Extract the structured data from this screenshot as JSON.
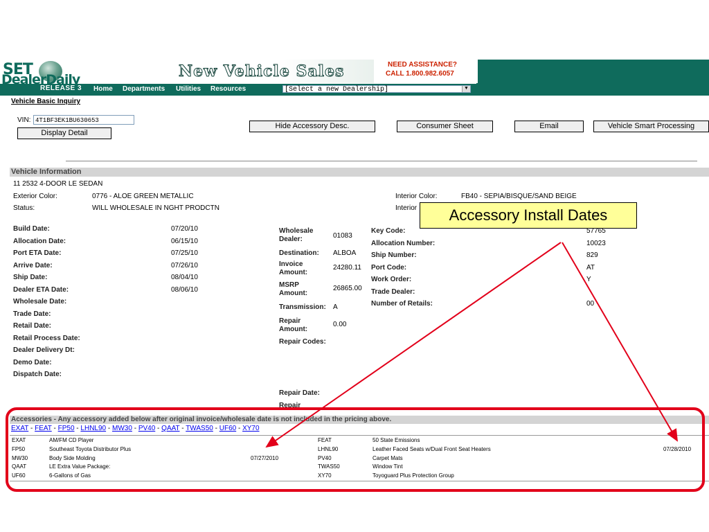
{
  "header": {
    "logo": {
      "line1": "SET",
      "line2": "DealerDaily",
      "release": "RELEASE 3"
    },
    "title": "New Vehicle Sales",
    "assist_line1": "NEED ASSISTANCE?",
    "assist_line2": "CALL 1.800.982.6057",
    "nav": [
      "Home",
      "Departments",
      "Utilities",
      "Resources"
    ],
    "dealer_select": "[Select a new Dealership]"
  },
  "breadcrumb": "Vehicle Basic Inquiry",
  "vin": {
    "label": "VIN:",
    "value": "4T1BF3EK1BU630653"
  },
  "buttons": {
    "display_detail": "Display Detail",
    "hide_accessory": "Hide Accessory Desc.",
    "consumer_sheet": "Consumer Sheet",
    "email": "Email",
    "smart_processing": "Vehicle Smart Processing"
  },
  "vehicle": {
    "section_title": "Vehicle Information",
    "model_line": "11 2532  4-DOOR LE SEDAN",
    "exterior_label": "Exterior Color:",
    "exterior_value": "0776 - ALOE GREEN METALLIC",
    "status_label": "Status:",
    "status_value": "WILL WHOLESALE IN NGHT PRODCTN",
    "interior_label": "Interior Color:",
    "interior_value": "FB40 - SEPIA/BISQUE/SAND BEIGE",
    "interior2_label": "Interior",
    "dates": [
      {
        "label": "Build Date:",
        "value": "07/20/10"
      },
      {
        "label": "Allocation Date:",
        "value": "06/15/10"
      },
      {
        "label": "Port ETA Date:",
        "value": "07/25/10"
      },
      {
        "label": "Arrive Date:",
        "value": "07/26/10"
      },
      {
        "label": "Ship Date:",
        "value": "08/04/10"
      },
      {
        "label": "Dealer ETA Date:",
        "value": "08/06/10"
      },
      {
        "label": "Wholesale Date:",
        "value": ""
      },
      {
        "label": "Trade Date:",
        "value": ""
      },
      {
        "label": "Retail Date:",
        "value": ""
      },
      {
        "label": "Retail Process Date:",
        "value": ""
      },
      {
        "label": "Dealer Delivery Dt:",
        "value": ""
      },
      {
        "label": "Demo Date:",
        "value": ""
      },
      {
        "label": "Dispatch Date:",
        "value": ""
      }
    ],
    "mid": [
      {
        "label": "Wholesale Dealer:",
        "value": "01083"
      },
      {
        "label": "Destination:",
        "value": "ALBOA"
      },
      {
        "label": "Invoice Amount:",
        "value": "24280.11"
      },
      {
        "label": "MSRP Amount:",
        "value": "26865.00"
      },
      {
        "label": "Transmission:",
        "value": "A"
      },
      {
        "label": "Repair Amount:",
        "value": "0.00"
      },
      {
        "label": "Repair Codes:",
        "value": ""
      },
      {
        "label": "Repair Date:",
        "value": ""
      },
      {
        "label": "Repair Comments:",
        "value": ""
      }
    ],
    "right": [
      {
        "label": "Key Code:",
        "value": "57765"
      },
      {
        "label": "Allocation Number:",
        "value": "10023"
      },
      {
        "label": "Ship Number:",
        "value": "829"
      },
      {
        "label": "Port Code:",
        "value": "AT"
      },
      {
        "label": "Work Order:",
        "value": "Y"
      },
      {
        "label": "Trade Dealer:",
        "value": ""
      },
      {
        "label": "Number of Retails:",
        "value": "00"
      }
    ]
  },
  "callout": "Accessory Install Dates",
  "accessories": {
    "header": "Accessories - Any accessory added below after original invoice/wholesale date is not included in the pricing above.",
    "codes": [
      "EXAT",
      "FEAT",
      "FP50",
      "LHNL90",
      "MW30",
      "PV40",
      "QAAT",
      "TWAS50",
      "UF60",
      "XY70"
    ],
    "left": [
      {
        "code": "EXAT",
        "desc": "AM/FM CD Player",
        "date": ""
      },
      {
        "code": "FP50",
        "desc": "Southeast Toyota Distributor Plus",
        "date": ""
      },
      {
        "code": "MW30",
        "desc": "Body Side Molding",
        "date": "07/27/2010"
      },
      {
        "code": "QAAT",
        "desc": "LE Extra Value Package:",
        "date": ""
      },
      {
        "code": "UF60",
        "desc": "6-Gallons of Gas",
        "date": ""
      }
    ],
    "right": [
      {
        "code": "FEAT",
        "desc": "50 State Emissions",
        "date": ""
      },
      {
        "code": "LHNL90",
        "desc": "Leather Faced Seats w/Dual Front Seat Heaters",
        "date": "07/28/2010"
      },
      {
        "code": "PV40",
        "desc": "Carpet Mats",
        "date": ""
      },
      {
        "code": "TWAS50",
        "desc": "Window Tint",
        "date": ""
      },
      {
        "code": "XY70",
        "desc": "Toyoguard Plus Protection Group",
        "date": ""
      }
    ]
  },
  "colors": {
    "brand_green": "#0f6b5c",
    "alert_red": "#e2001a",
    "callout_yellow": "#ffff99"
  }
}
